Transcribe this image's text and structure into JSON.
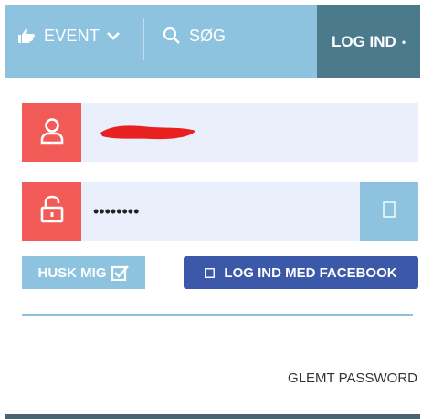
{
  "header": {
    "event_label": "EVENT",
    "search_label": "SØG",
    "login_label": "LOG IND",
    "login_dot": "•"
  },
  "login_form": {
    "username_value": "",
    "password_value": "••••••••",
    "remember_label": "HUSK MIG",
    "facebook_label": "LOG IND MED FACEBOOK",
    "forgot_label": "GLEMT PASSWORD"
  },
  "colors": {
    "topbar": "#8ec3e0",
    "login_tab": "#4a7a8c",
    "icon_box": "#f15a56",
    "field_bg": "#e9f0fb",
    "facebook": "#3b59a8"
  },
  "icons": [
    "hand-pointer-icon",
    "chevron-down-icon",
    "search-icon",
    "user-icon",
    "unlock-icon",
    "eye-toggle-icon",
    "checkbox-icon",
    "facebook-icon"
  ]
}
